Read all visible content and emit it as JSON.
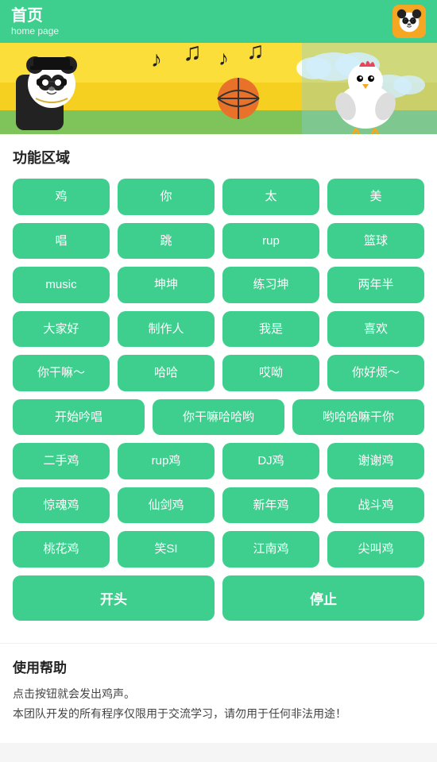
{
  "header": {
    "title": "首页",
    "subtitle": "home page",
    "avatar_label": "panda-avatar"
  },
  "banner": {
    "alt": "Panda DJ banner with music notes, basketball, and chicken character"
  },
  "function_area": {
    "title": "功能区域",
    "buttons": [
      {
        "label": "鸡",
        "wide": false
      },
      {
        "label": "你",
        "wide": false
      },
      {
        "label": "太",
        "wide": false
      },
      {
        "label": "美",
        "wide": false
      },
      {
        "label": "唱",
        "wide": false
      },
      {
        "label": "跳",
        "wide": false
      },
      {
        "label": "rup",
        "wide": false
      },
      {
        "label": "篮球",
        "wide": false
      },
      {
        "label": "music",
        "wide": false
      },
      {
        "label": "坤坤",
        "wide": false
      },
      {
        "label": "练习坤",
        "wide": false
      },
      {
        "label": "两年半",
        "wide": false
      },
      {
        "label": "大家好",
        "wide": false
      },
      {
        "label": "制作人",
        "wide": false
      },
      {
        "label": "我是",
        "wide": false
      },
      {
        "label": "喜欢",
        "wide": false
      },
      {
        "label": "你干嘛～",
        "wide": false
      },
      {
        "label": "哈哈",
        "wide": false
      },
      {
        "label": "哎呦",
        "wide": false
      },
      {
        "label": "你好烦～",
        "wide": false
      },
      {
        "label": "开始吟唱",
        "wide": true
      },
      {
        "label": "你干嘛哈哈哟",
        "wide": true
      },
      {
        "label": "哟哈哈嘛干你",
        "wide": true
      },
      {
        "label": "二手鸡",
        "wide": false
      },
      {
        "label": "rup鸡",
        "wide": false
      },
      {
        "label": "DJ鸡",
        "wide": false
      },
      {
        "label": "谢谢鸡",
        "wide": false
      },
      {
        "label": "惊魂鸡",
        "wide": false
      },
      {
        "label": "仙剑鸡",
        "wide": false
      },
      {
        "label": "新年鸡",
        "wide": false
      },
      {
        "label": "战斗鸡",
        "wide": false
      },
      {
        "label": "桃花鸡",
        "wide": false
      },
      {
        "label": "笑SI",
        "wide": false
      },
      {
        "label": "江南鸡",
        "wide": false
      },
      {
        "label": "尖叫鸡",
        "wide": false
      }
    ]
  },
  "actions": {
    "start_label": "开头",
    "stop_label": "停止"
  },
  "help": {
    "title": "使用帮助",
    "line1": "点击按钮就会发出鸡声。",
    "line2": "本团队开发的所有程序仅限用于交流学习，请勿用于任何非法用途！"
  }
}
